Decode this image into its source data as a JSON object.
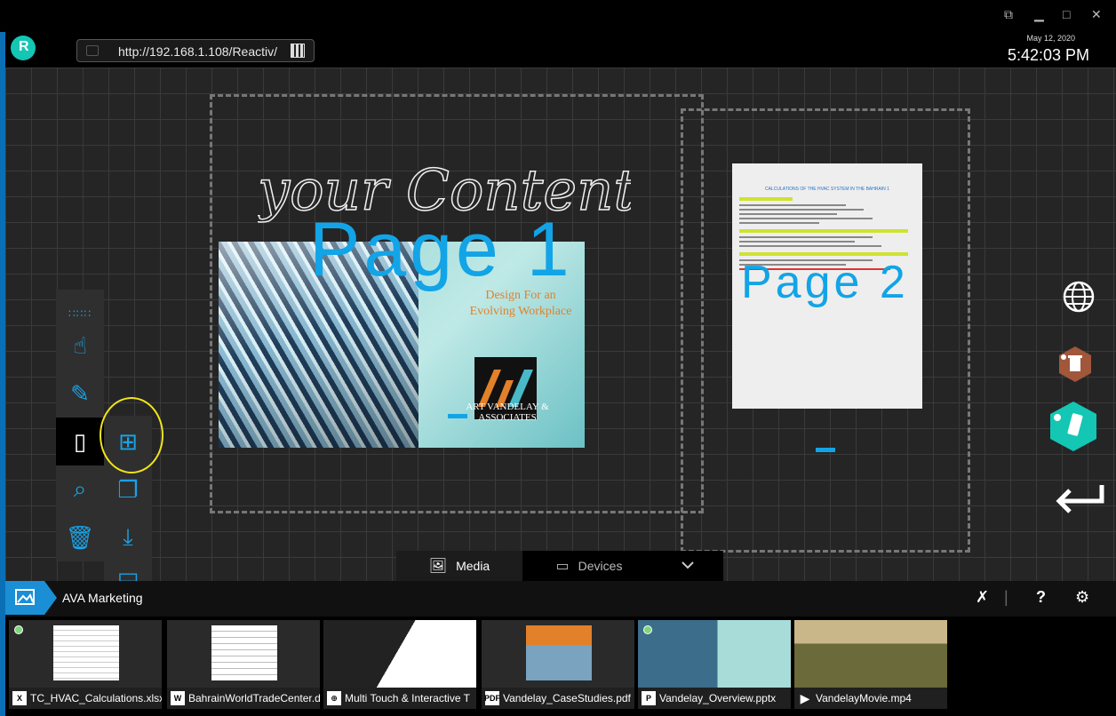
{
  "window": {
    "url": "http://192.168.1.108/Reactiv/",
    "date": "May 12, 2020",
    "time": "5:42:03 PM"
  },
  "canvas": {
    "handwriting": "your Content",
    "page1_label": "Page 1",
    "page2_label": "Page 2",
    "slide": {
      "headline": "Design For an Evolving Workplace",
      "company": "ART VANDELAY & ASSOCIATES"
    },
    "doc_title": "CALCULATIONS OF THE HVAC SYSTEM IN THE BAHRAIN 1"
  },
  "tabs": {
    "media_label": "Media",
    "devices_label": "Devices"
  },
  "mediabar": {
    "folder_label": "AVA Marketing",
    "help_label": "?"
  },
  "files": [
    {
      "name": "TC_HVAC_Calculations.xlsx",
      "icon": "X",
      "active": true
    },
    {
      "name": "BahrainWorldTradeCenter.d",
      "icon": "W",
      "active": false
    },
    {
      "name": "Multi Touch & Interactive T",
      "icon": "globe",
      "active": false
    },
    {
      "name": "Vandelay_CaseStudies.pdf",
      "icon": "PDF",
      "active": false
    },
    {
      "name": "Vandelay_Overview.pptx",
      "icon": "P",
      "active": true
    },
    {
      "name": "VandelayMovie.mp4",
      "icon": "play",
      "active": false
    }
  ],
  "colors": {
    "accent": "#12a4e6",
    "teal": "#14c6b4",
    "highlight": "#f2e51a"
  }
}
